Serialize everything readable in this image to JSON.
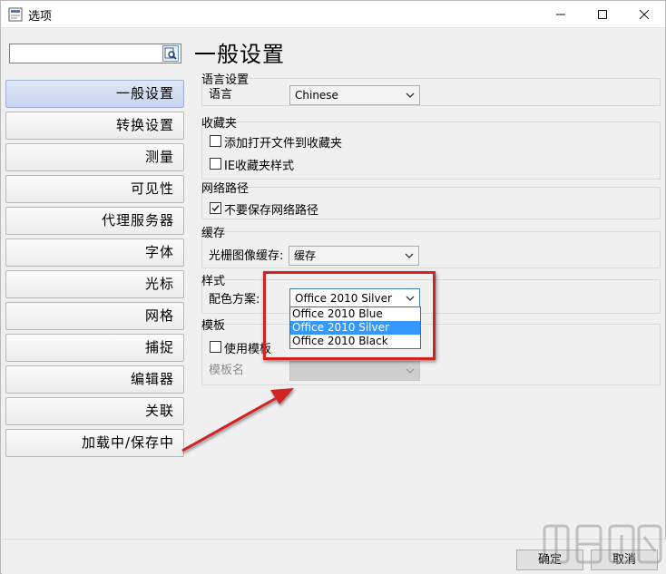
{
  "window": {
    "title": "选项",
    "controls": {
      "minimize": "—",
      "maximize": "☐",
      "close": "✕"
    }
  },
  "search": {
    "value": "",
    "placeholder": ""
  },
  "nav": {
    "items": [
      {
        "label": "一般设置",
        "selected": true
      },
      {
        "label": "转换设置",
        "selected": false
      },
      {
        "label": "测量",
        "selected": false
      },
      {
        "label": "可见性",
        "selected": false
      },
      {
        "label": "代理服务器",
        "selected": false
      },
      {
        "label": "字体",
        "selected": false
      },
      {
        "label": "光标",
        "selected": false
      },
      {
        "label": "网格",
        "selected": false
      },
      {
        "label": "捕捉",
        "selected": false
      },
      {
        "label": "编辑器",
        "selected": false
      },
      {
        "label": "关联",
        "selected": false
      },
      {
        "label": "加载中/保存中",
        "selected": false
      }
    ]
  },
  "page": {
    "title": "一般设置"
  },
  "language": {
    "group_title": "语言设置",
    "label": "语言",
    "value": "Chinese"
  },
  "favorites": {
    "group_title": "收藏夹",
    "add_open_files": {
      "label": "添加打开文件到收藏夹",
      "checked": false
    },
    "ie_style": {
      "label": "IE收藏夹样式",
      "checked": false
    }
  },
  "network": {
    "group_title": "网络路径",
    "no_save": {
      "label": "不要保存网络路径",
      "checked": true
    }
  },
  "cache": {
    "group_title": "缓存",
    "label": "光栅图像缓存:",
    "value": "缓存"
  },
  "style": {
    "group_title": "样式",
    "label": "配色方案:",
    "value": "Office 2010 Silver",
    "options": [
      "Office 2010 Blue",
      "Office 2010 Silver",
      "Office 2010 Black"
    ],
    "highlighted": "Office 2010 Silver"
  },
  "template": {
    "group_title": "模板",
    "use": {
      "label": "使用模板",
      "checked": false
    },
    "name_label": "模板名",
    "name_value": ""
  },
  "footer": {
    "ok": "确定",
    "cancel": "取消"
  },
  "colors": {
    "accent_red": "#d22323",
    "selection_blue": "#3399ff",
    "nav_selected": "#c8d4ef"
  }
}
